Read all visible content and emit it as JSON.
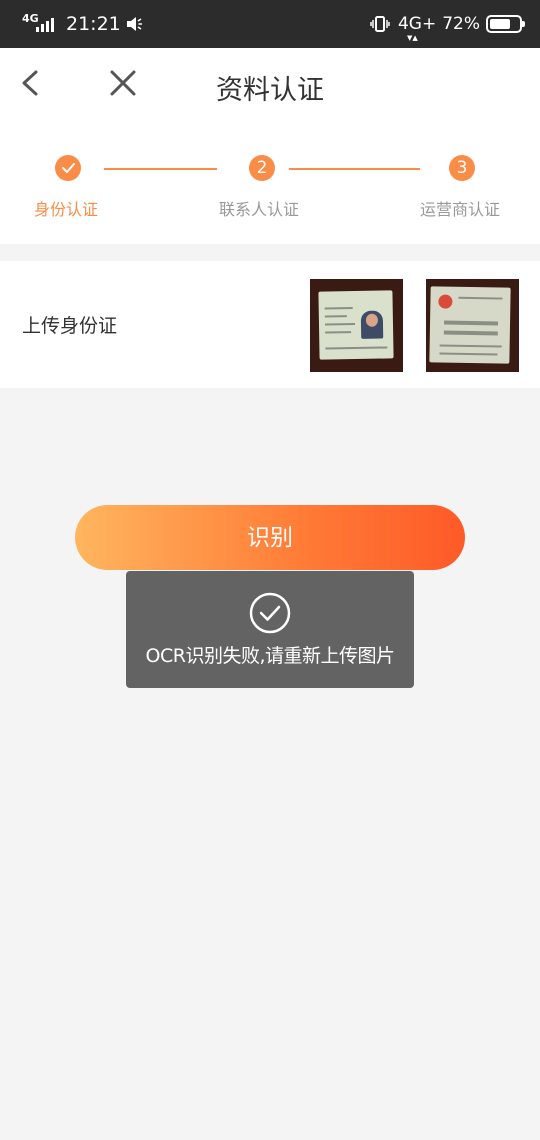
{
  "status_bar": {
    "network_left": "4G",
    "time": "21:21",
    "network_right": "4G+",
    "battery_percent": "72%",
    "battery_level": 0.72
  },
  "header": {
    "title": "资料认证",
    "back_icon": "chevron-left-icon",
    "close_icon": "close-icon"
  },
  "steps": [
    {
      "number": "",
      "label": "身份认证",
      "state": "done"
    },
    {
      "number": "2",
      "label": "联系人认证",
      "state": "pending"
    },
    {
      "number": "3",
      "label": "运营商认证",
      "state": "pending"
    }
  ],
  "upload": {
    "label": "上传身份证",
    "images": [
      "id-card-front",
      "id-card-back"
    ]
  },
  "recognize_button": {
    "label": "识别"
  },
  "toast": {
    "icon": "check-circle-icon",
    "message": "OCR识别失败,请重新上传图片"
  },
  "colors": {
    "accent": "#f98d47",
    "button_gradient_start": "#ffb55e",
    "button_gradient_end": "#ff5a28",
    "statusbar_bg": "#2c2c2c",
    "toast_bg": "#636363"
  }
}
